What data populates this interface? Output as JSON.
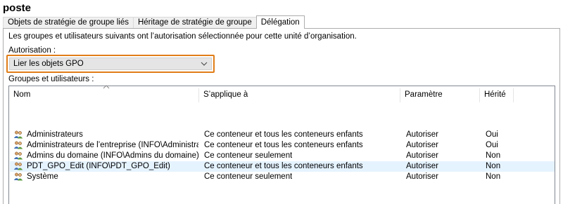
{
  "window": {
    "title": "poste"
  },
  "tabs": [
    {
      "label": "Objets de stratégie de groupe liés"
    },
    {
      "label": "Héritage de stratégie de groupe"
    },
    {
      "label": "Délégation"
    }
  ],
  "delegation": {
    "description": "Les groupes et utilisateurs suivants ont l’autorisation sélectionnée pour cette unité d’organisation.",
    "permission_label": "Autorisation :",
    "permission_value": "Lier les objets GPO",
    "groups_label": "Groupes et utilisateurs :",
    "highlight_color": "#e07d18",
    "selected_row_color": "#e5f3ff"
  },
  "table": {
    "columns": [
      "Nom",
      "S’applique à",
      "Paramètre",
      "Hérité"
    ],
    "rows": [
      {
        "icon": "group-icon",
        "name": "Administrateurs",
        "applies": "Ce conteneur et tous les conteneurs enfants",
        "setting": "Autoriser",
        "inherited": "Oui"
      },
      {
        "icon": "group-icon",
        "name": "Administrateurs de l’entreprise (INFO\\Administrateurs de l’...",
        "applies": "Ce conteneur et tous les conteneurs enfants",
        "setting": "Autoriser",
        "inherited": "Oui"
      },
      {
        "icon": "group-icon",
        "name": "Admins du domaine (INFO\\Admins du domaine)",
        "applies": "Ce conteneur seulement",
        "setting": "Autoriser",
        "inherited": "Non"
      },
      {
        "icon": "group-icon",
        "name": "PDT_GPO_Edit (INFO\\PDT_GPO_Edit)",
        "applies": "Ce conteneur et tous les conteneurs enfants",
        "setting": "Autoriser",
        "inherited": "Non",
        "selected": true
      },
      {
        "icon": "group-icon",
        "name": "Système",
        "applies": "Ce conteneur seulement",
        "setting": "Autoriser",
        "inherited": "Non"
      }
    ]
  }
}
